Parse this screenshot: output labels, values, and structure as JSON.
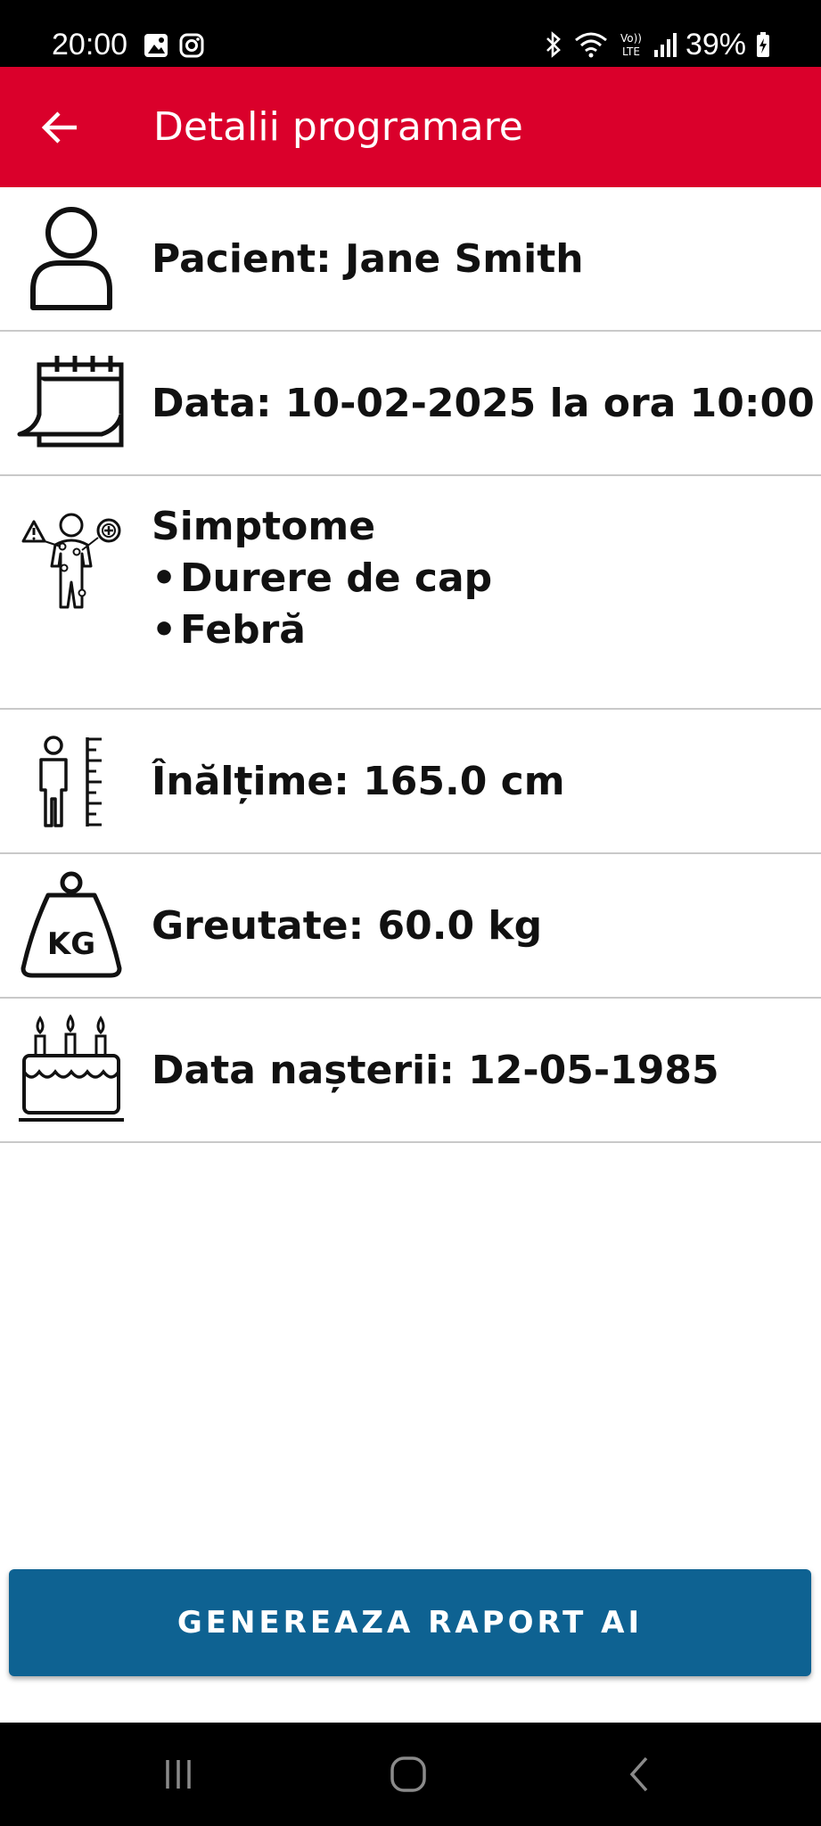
{
  "status_bar": {
    "time": "20:00",
    "battery": "39%",
    "icons": [
      "image-icon",
      "instagram-icon",
      "bluetooth-icon",
      "wifi-icon",
      "volte-icon",
      "signal-icon",
      "battery-charging-icon"
    ]
  },
  "app_bar": {
    "title": "Detalii programare",
    "back_icon": "arrow-left-icon",
    "background": "#DA002B"
  },
  "details": {
    "patient": "Pacient: Jane Smith",
    "date": "Data: 10-02-2025 la ora 10:00",
    "symptoms": {
      "heading": "Simptome",
      "bullet": "•",
      "items": [
        "Durere de cap",
        "Febră"
      ]
    },
    "height": "Înălțime: 165.0 cm",
    "weight": "Greutate: 60.0 kg",
    "weight_icon_label": "KG",
    "birth_date": "Data nașterii: 12-05-1985"
  },
  "actions": {
    "generate_label": "GENEREAZA RAPORT AI",
    "button_color": "#0E6292"
  },
  "nav_bar": {
    "icons": [
      "recent-apps-icon",
      "home-icon",
      "back-nav-icon"
    ]
  }
}
